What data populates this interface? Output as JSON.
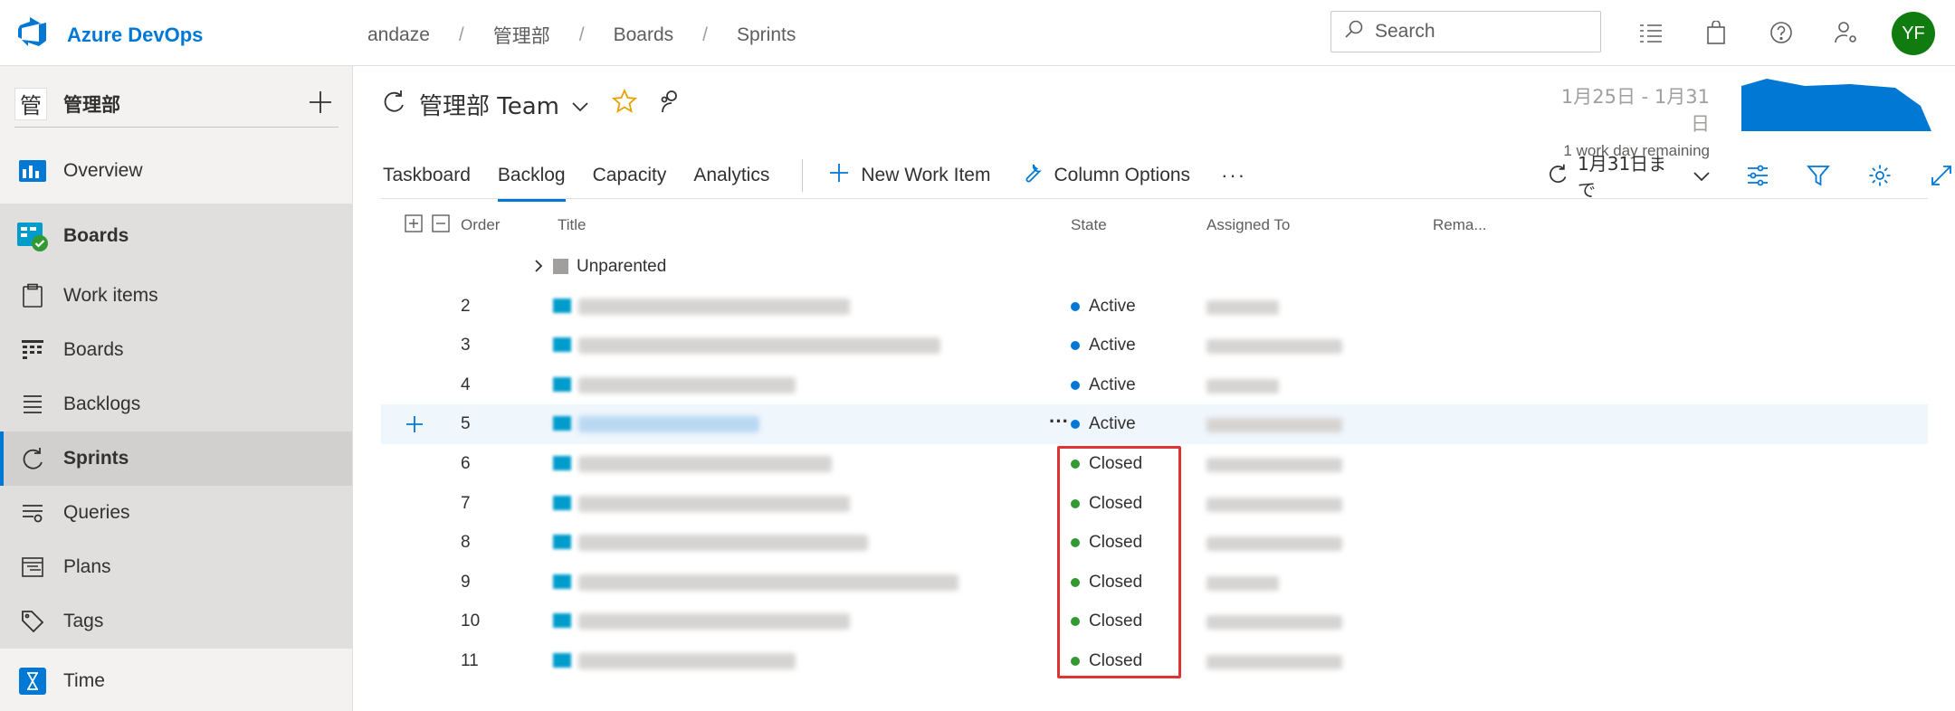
{
  "app": {
    "title": "Azure DevOps",
    "user_initials": "YF",
    "brand_color": "#0078d4",
    "avatar_color": "#107c10"
  },
  "breadcrumb": [
    "andaze",
    "管理部",
    "Boards",
    "Sprints"
  ],
  "search": {
    "placeholder": "Search"
  },
  "top_icons": [
    "task-list-icon",
    "shopping-bag-icon",
    "help-icon",
    "user-settings-icon"
  ],
  "sidebar": {
    "project_badge": "管",
    "project_name": "管理部",
    "items": [
      {
        "label": "Overview",
        "icon": "overview-icon"
      },
      {
        "label": "Boards",
        "icon": "boards-hub-icon"
      },
      {
        "label": "Work items",
        "icon": "work-items-icon"
      },
      {
        "label": "Boards",
        "icon": "kanban-icon"
      },
      {
        "label": "Backlogs",
        "icon": "backlogs-icon"
      },
      {
        "label": "Sprints",
        "icon": "sprints-icon"
      },
      {
        "label": "Queries",
        "icon": "queries-icon"
      },
      {
        "label": "Plans",
        "icon": "plans-icon"
      },
      {
        "label": "Tags",
        "icon": "tag-icon"
      },
      {
        "label": "Time",
        "icon": "time-icon"
      }
    ]
  },
  "header": {
    "team": "管理部 Team",
    "date_range": "1月25日 - 1月31日",
    "remaining": "1 work day remaining",
    "sprint_selector": "1月31日まで"
  },
  "tabs": [
    "Taskboard",
    "Backlog",
    "Capacity",
    "Analytics"
  ],
  "active_tab": "Backlog",
  "toolbar": {
    "new_work_item": "New Work Item",
    "column_options": "Column Options",
    "more": "···"
  },
  "columns": {
    "order": "Order",
    "title": "Title",
    "state": "State",
    "assigned_to": "Assigned To",
    "remaining": "Rema..."
  },
  "unparented_label": "Unparented",
  "state_colors": {
    "Active": "#0078d4",
    "Closed": "#339933"
  },
  "rows": [
    {
      "order": "2",
      "state": "Active"
    },
    {
      "order": "3",
      "state": "Active"
    },
    {
      "order": "4",
      "state": "Active"
    },
    {
      "order": "5",
      "state": "Active"
    },
    {
      "order": "6",
      "state": "Closed"
    },
    {
      "order": "7",
      "state": "Closed"
    },
    {
      "order": "8",
      "state": "Closed"
    },
    {
      "order": "9",
      "state": "Closed"
    },
    {
      "order": "10",
      "state": "Closed"
    },
    {
      "order": "11",
      "state": "Closed"
    }
  ]
}
